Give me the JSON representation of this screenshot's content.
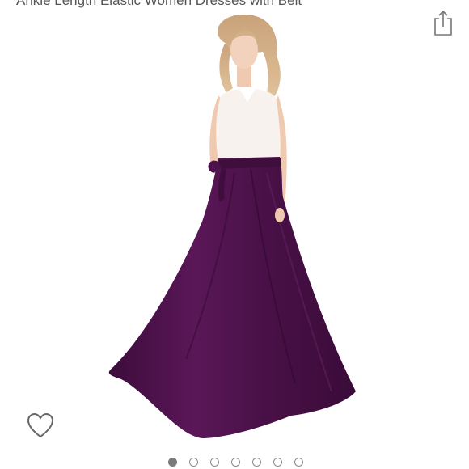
{
  "product": {
    "title": "Ankle Length Elastic Women Dresses with Belt"
  },
  "icons": {
    "share": "share-icon",
    "favorite": "heart-outline-icon"
  },
  "gallery": {
    "image_count": 7,
    "active_index": 0
  },
  "colors": {
    "skirt": "#4a1148",
    "top": "#f7f2ee",
    "dot_active": "#7a7a7a"
  }
}
